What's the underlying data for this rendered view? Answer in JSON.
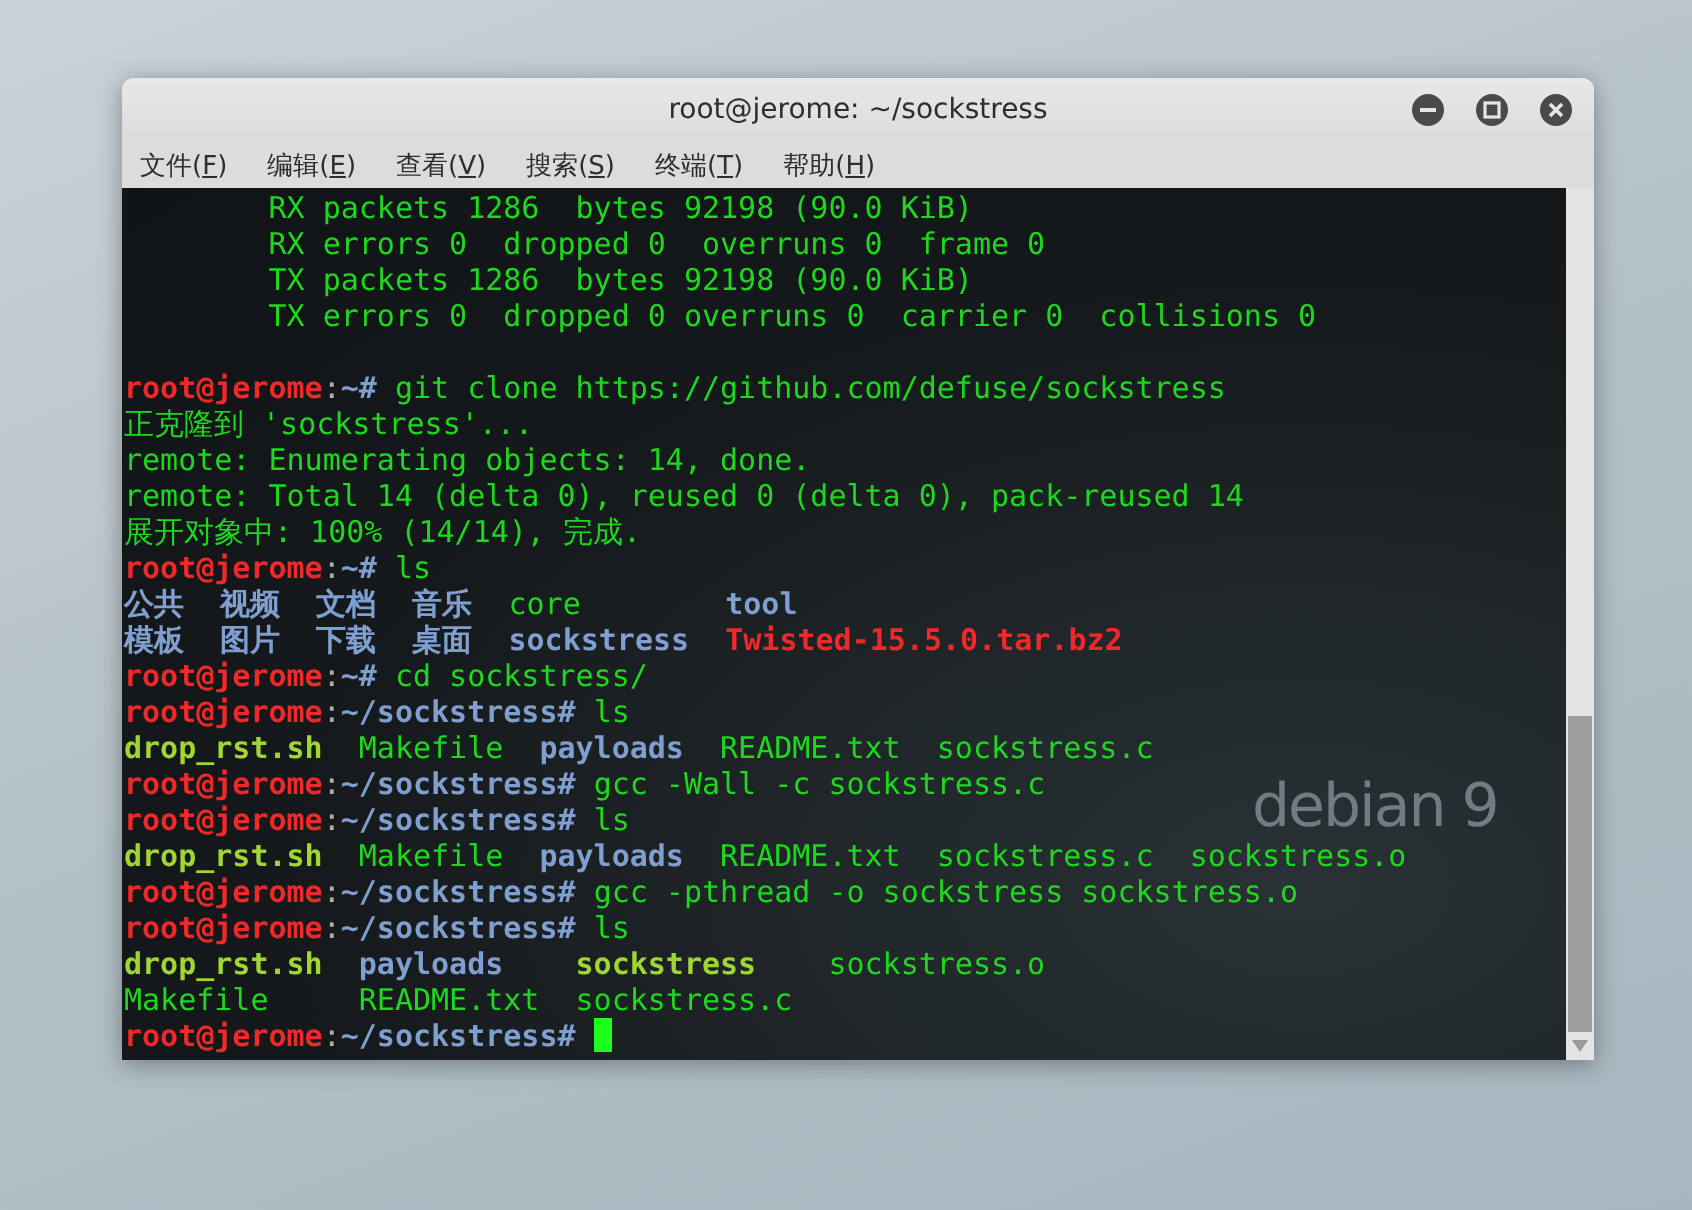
{
  "window": {
    "title": "root@jerome: ~/sockstress"
  },
  "menu": [
    {
      "label": "文件(",
      "key": "F",
      "end": ")"
    },
    {
      "label": "编辑(",
      "key": "E",
      "end": ")"
    },
    {
      "label": "查看(",
      "key": "V",
      "end": ")"
    },
    {
      "label": "搜索(",
      "key": "S",
      "end": ")"
    },
    {
      "label": "终端(",
      "key": "T",
      "end": ")"
    },
    {
      "label": "帮助(",
      "key": "H",
      "end": ")"
    }
  ],
  "wallpaper": {
    "logo": "debian 9"
  },
  "terminal": {
    "lines": [
      {
        "kind": "output",
        "segments": [
          {
            "text": "        RX packets 1286  bytes 92198 (90.0 KiB)",
            "kind": "plain"
          }
        ]
      },
      {
        "kind": "output",
        "segments": [
          {
            "text": "        RX errors 0  dropped 0  overruns 0  frame 0",
            "kind": "plain"
          }
        ]
      },
      {
        "kind": "output",
        "segments": [
          {
            "text": "        TX packets 1286  bytes 92198 (90.0 KiB)",
            "kind": "plain"
          }
        ]
      },
      {
        "kind": "output",
        "segments": [
          {
            "text": "        TX errors 0  dropped 0 overruns 0  carrier 0  collisions 0",
            "kind": "plain"
          }
        ]
      },
      {
        "kind": "blank"
      },
      {
        "kind": "prompt",
        "user": "root@jerome",
        "sep": ":",
        "path": "~#",
        "command": "git clone https://github.com/defuse/sockstress"
      },
      {
        "kind": "output",
        "segments": [
          {
            "text": "正克隆到 'sockstress'...",
            "kind": "plain"
          }
        ]
      },
      {
        "kind": "output",
        "segments": [
          {
            "text": "remote: Enumerating objects: 14, done.",
            "kind": "plain"
          }
        ]
      },
      {
        "kind": "output",
        "segments": [
          {
            "text": "remote: Total 14 (delta 0), reused 0 (delta 0), pack-reused 14",
            "kind": "plain"
          }
        ]
      },
      {
        "kind": "output",
        "segments": [
          {
            "text": "展开对象中: 100% (14/14), 完成.",
            "kind": "plain"
          }
        ]
      },
      {
        "kind": "prompt",
        "user": "root@jerome",
        "sep": ":",
        "path": "~#",
        "command": "ls"
      },
      {
        "kind": "output",
        "segments": [
          {
            "text": "公共  ",
            "kind": "dir"
          },
          {
            "text": "视频  ",
            "kind": "dir"
          },
          {
            "text": "文档  ",
            "kind": "dir"
          },
          {
            "text": "音乐  ",
            "kind": "dir"
          },
          {
            "text": "core        ",
            "kind": "plain"
          },
          {
            "text": "tool",
            "kind": "dir"
          }
        ]
      },
      {
        "kind": "output",
        "segments": [
          {
            "text": "模板  ",
            "kind": "dir"
          },
          {
            "text": "图片  ",
            "kind": "dir"
          },
          {
            "text": "下载  ",
            "kind": "dir"
          },
          {
            "text": "桌面  ",
            "kind": "dir"
          },
          {
            "text": "sockstress  ",
            "kind": "dir"
          },
          {
            "text": "Twisted-15.5.0.tar.bz2",
            "kind": "archive"
          }
        ]
      },
      {
        "kind": "prompt",
        "user": "root@jerome",
        "sep": ":",
        "path": "~#",
        "command": "cd sockstress/"
      },
      {
        "kind": "prompt",
        "user": "root@jerome",
        "sep": ":",
        "path": "~/sockstress#",
        "command": "ls"
      },
      {
        "kind": "output",
        "segments": [
          {
            "text": "drop_rst.sh  ",
            "kind": "exec"
          },
          {
            "text": "Makefile  ",
            "kind": "plain"
          },
          {
            "text": "payloads  ",
            "kind": "dir"
          },
          {
            "text": "README.txt  ",
            "kind": "plain"
          },
          {
            "text": "sockstress.c",
            "kind": "plain"
          }
        ]
      },
      {
        "kind": "prompt",
        "user": "root@jerome",
        "sep": ":",
        "path": "~/sockstress#",
        "command": "gcc -Wall -c sockstress.c"
      },
      {
        "kind": "prompt",
        "user": "root@jerome",
        "sep": ":",
        "path": "~/sockstress#",
        "command": "ls"
      },
      {
        "kind": "output",
        "segments": [
          {
            "text": "drop_rst.sh  ",
            "kind": "exec"
          },
          {
            "text": "Makefile  ",
            "kind": "plain"
          },
          {
            "text": "payloads  ",
            "kind": "dir"
          },
          {
            "text": "README.txt  ",
            "kind": "plain"
          },
          {
            "text": "sockstress.c  ",
            "kind": "plain"
          },
          {
            "text": "sockstress.o",
            "kind": "plain"
          }
        ]
      },
      {
        "kind": "prompt",
        "user": "root@jerome",
        "sep": ":",
        "path": "~/sockstress#",
        "command": "gcc -pthread -o sockstress sockstress.o"
      },
      {
        "kind": "prompt",
        "user": "root@jerome",
        "sep": ":",
        "path": "~/sockstress#",
        "command": "ls"
      },
      {
        "kind": "output",
        "segments": [
          {
            "text": "drop_rst.sh  ",
            "kind": "exec"
          },
          {
            "text": "payloads    ",
            "kind": "dir"
          },
          {
            "text": "sockstress    ",
            "kind": "exec"
          },
          {
            "text": "sockstress.o",
            "kind": "plain"
          }
        ]
      },
      {
        "kind": "output",
        "segments": [
          {
            "text": "Makefile     ",
            "kind": "plain"
          },
          {
            "text": "README.txt  ",
            "kind": "plain"
          },
          {
            "text": "sockstress.c",
            "kind": "plain"
          }
        ]
      },
      {
        "kind": "prompt",
        "user": "root@jerome",
        "sep": ":",
        "path": "~/sockstress#",
        "cursor": true
      }
    ]
  }
}
